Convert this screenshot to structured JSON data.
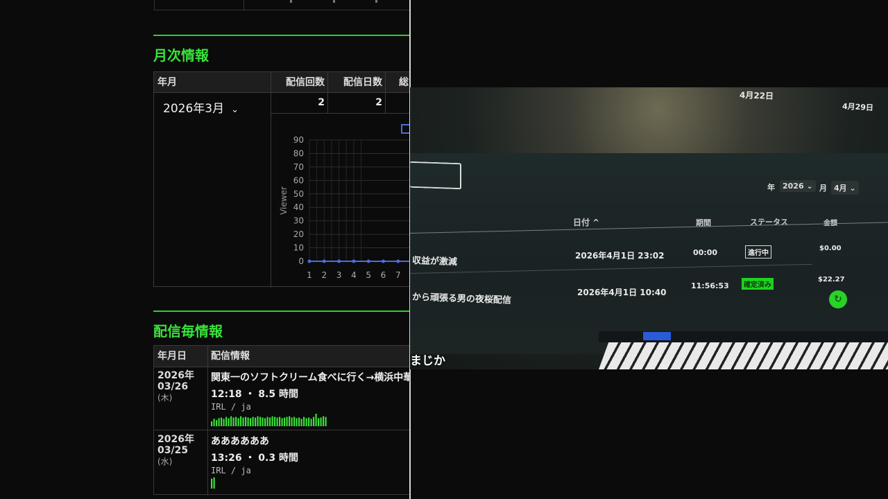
{
  "monthly": {
    "title": "月次情報",
    "headers": [
      "年月",
      "配信回数",
      "配信日数",
      "総"
    ],
    "selected_month": "2026年3月",
    "stream_count": "2",
    "stream_days": "2"
  },
  "chart_data": {
    "type": "line",
    "ylabel": "Viewer",
    "ylim": [
      0,
      90
    ],
    "y_ticks": [
      "90",
      "80",
      "70",
      "60",
      "50",
      "40",
      "30",
      "20",
      "10",
      "0"
    ],
    "x": [
      "1",
      "2",
      "3",
      "4",
      "5",
      "6",
      "7"
    ],
    "series": [
      {
        "values": [
          0,
          0,
          0,
          0,
          0,
          0,
          0
        ],
        "color": "#4a6ee0"
      }
    ]
  },
  "streams": {
    "title": "配信毎情報",
    "headers": [
      "年月日",
      "配信情報"
    ],
    "rows": [
      {
        "year": "2026年",
        "date": "03/26",
        "weekday": "(木)",
        "title": "関東一のソフトクリーム食べに行く→横浜中華",
        "duration": "12:18 ・ 8.5 時間",
        "category": "IRL / ja",
        "spark": [
          10,
          14,
          12,
          15,
          16,
          14,
          17,
          15,
          18,
          16,
          17,
          15,
          18,
          16,
          17,
          16,
          15,
          17,
          16,
          18,
          17,
          16,
          15,
          17,
          16,
          18,
          17,
          16,
          17,
          15,
          16,
          17,
          18,
          16,
          17,
          15,
          16,
          14,
          17,
          15,
          16,
          14,
          17,
          22,
          15,
          16,
          18,
          17
        ]
      },
      {
        "year": "2026年",
        "date": "03/25",
        "weekday": "(水)",
        "title": "ああああああ",
        "duration": "13:26 ・ 0.3 時間",
        "category": "IRL / ja",
        "spark": [
          18,
          20
        ]
      }
    ]
  },
  "photo": {
    "date_a": "4月22日",
    "date_b": "4月29日",
    "year_label": "年",
    "year_value": "2026",
    "month_label": "月",
    "month_value": "4月",
    "col_date": "日付 ^",
    "col_period": "期間",
    "col_status": "ステータス",
    "col_amount": "金額",
    "row1_title": "収益が激減",
    "row1_date": "2026年4月1日 23:02",
    "row1_period": "00:00",
    "row1_status": "進行中",
    "row1_amount": "$0.00",
    "row2_title": "から頑張る男の夜桜配信",
    "row2_date": "2026年4月1日 10:40",
    "row2_period": "11:56:53",
    "row2_status": "確定済み",
    "row2_amount": "$22.27",
    "caption": "まじか"
  },
  "colors": {
    "accent": "#39e23a",
    "chart_line": "#4a6ee0"
  }
}
